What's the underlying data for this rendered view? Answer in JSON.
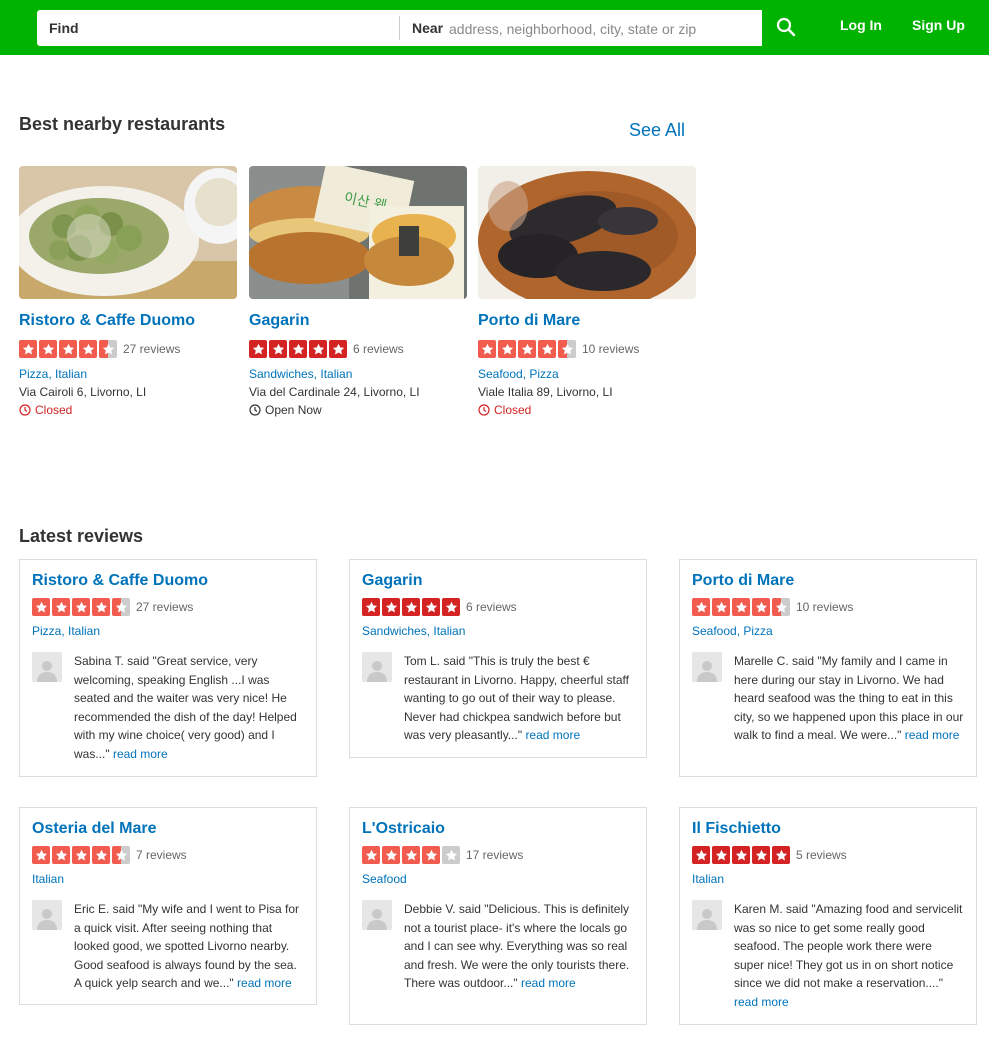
{
  "header": {
    "find_label": "Find",
    "near_label": "Near",
    "near_placeholder": "address, neighborhood, city, state or zip",
    "login": "Log In",
    "signup": "Sign Up"
  },
  "nearby": {
    "title": "Best nearby restaurants",
    "see_all": "See All",
    "cards": [
      {
        "name": "Ristoro & Caffe Duomo",
        "rating": 4.5,
        "reviews": "27 reviews",
        "cats": "Pizza, Italian",
        "addr": "Via Cairoli 6, Livorno, LI",
        "status": "Closed"
      },
      {
        "name": "Gagarin",
        "rating": 5,
        "reviews": "6 reviews",
        "cats": "Sandwiches, Italian",
        "addr": "Via del Cardinale 24, Livorno, LI",
        "status": "Open Now"
      },
      {
        "name": "Porto di Mare",
        "rating": 4.5,
        "reviews": "10 reviews",
        "cats": "Seafood, Pizza",
        "addr": "Viale Italia 89, Livorno, LI",
        "status": "Closed"
      }
    ]
  },
  "latest": {
    "title": "Latest reviews",
    "read_more": "read more",
    "items": [
      {
        "name": "Ristoro & Caffe Duomo",
        "rating": 4.5,
        "reviews": "27 reviews",
        "cats": "Pizza, Italian",
        "text": "Sabina T. said \"Great service, very welcoming, speaking English ...I was seated and the waiter was very nice! He recommended the dish of the day! Helped with my wine choice( very good) and I was...\""
      },
      {
        "name": "Gagarin",
        "rating": 5,
        "reviews": "6 reviews",
        "cats": "Sandwiches, Italian",
        "text": "Tom L. said \"This is truly the best € restaurant in Livorno. Happy, cheerful staff wanting to go out of their way to please. Never had chickpea sandwich before but was very pleasantly...\""
      },
      {
        "name": "Porto di Mare",
        "rating": 4.5,
        "reviews": "10 reviews",
        "cats": "Seafood, Pizza",
        "text": "Marelle C. said \"My family and I came in here during our stay in Livorno. We had heard seafood was the thing to eat in this city, so we happened upon this place in our walk to find a meal. We were...\""
      },
      {
        "name": "Osteria del Mare",
        "rating": 4.5,
        "reviews": "7 reviews",
        "cats": "Italian",
        "text": "Eric E. said \"My wife and I went to Pisa for a quick visit. After seeing nothing that looked good, we spotted Livorno nearby. Good seafood is always found by the sea. A quick yelp search and we...\""
      },
      {
        "name": "L'Ostricaio",
        "rating": 4,
        "reviews": "17 reviews",
        "cats": "Seafood",
        "text": "Debbie V. said \"Delicious. This is definitely not a tourist place- it's where the locals go and I can see why. Everything was so real and fresh. We were the only tourists there. There was outdoor...\""
      },
      {
        "name": "Il Fischietto",
        "rating": 5,
        "reviews": "5 reviews",
        "cats": "Italian",
        "text": "Karen M. said \"Amazing food and servicelit was so nice to get some really good seafood. The people work there were super nice! They got us in on short notice since we did not make a reservation....\""
      }
    ]
  },
  "colors": {
    "header_green": "#00b300",
    "link_blue": "#0073bb",
    "star_red_45": "#f15c4f",
    "star_red_5": "#d32323",
    "star_empty": "#cccccc",
    "closed_red": "#d32323"
  }
}
